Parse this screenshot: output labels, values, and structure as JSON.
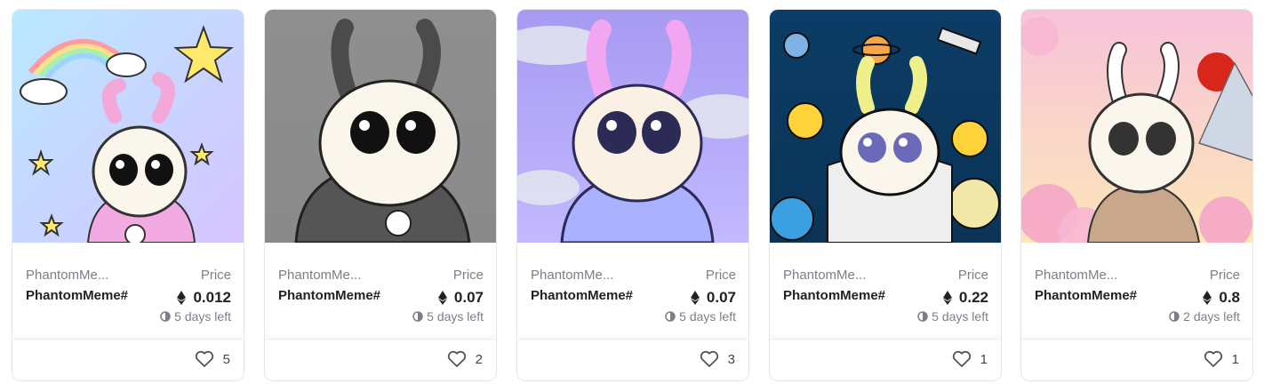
{
  "price_label": "Price",
  "colors": {
    "muted": "#7a7f87",
    "text": "#222222",
    "border": "#e6e6ea"
  },
  "icons": {
    "currency": "ethereum-icon",
    "time": "clock-icon",
    "like": "heart-icon"
  },
  "cards": [
    {
      "collection": "PhantomMe...",
      "name": "PhantomMeme#",
      "price": "0.012",
      "time_left": "5 days left",
      "likes": "5",
      "art": {
        "bg_top": "#b9e9ff",
        "bg_bottom": "#d6c3ff",
        "horn": "#f2a8d8",
        "outfit": "#f3a9e2",
        "theme": "rainbow-stars"
      }
    },
    {
      "collection": "PhantomMe...",
      "name": "PhantomMeme#",
      "price": "0.07",
      "time_left": "5 days left",
      "likes": "2",
      "art": {
        "bg_top": "#8f8f8f",
        "bg_bottom": "#8a8a8a",
        "horn": "#4b4b4b",
        "outfit": "#555555",
        "theme": "grey-hoodie"
      }
    },
    {
      "collection": "PhantomMe...",
      "name": "PhantomMeme#",
      "price": "0.07",
      "time_left": "5 days left",
      "likes": "3",
      "art": {
        "bg_top": "#a79af2",
        "bg_bottom": "#c2b8ff",
        "horn": "#f0a6f0",
        "outfit": "#aab2ff",
        "theme": "clouds"
      }
    },
    {
      "collection": "PhantomMe...",
      "name": "PhantomMeme#",
      "price": "0.22",
      "time_left": "5 days left",
      "likes": "1",
      "art": {
        "bg_top": "#0c3d66",
        "bg_bottom": "#0b3357",
        "horn": "#f0f08a",
        "outfit": "#eeeeee",
        "theme": "space"
      }
    },
    {
      "collection": "PhantomMe...",
      "name": "PhantomMeme#",
      "price": "0.8",
      "time_left": "2 days left",
      "likes": "1",
      "art": {
        "bg_top": "#f7c3da",
        "bg_bottom": "#fde6b8",
        "horn": "#ffffff",
        "outfit": "#c9a78a",
        "theme": "sakura"
      }
    }
  ]
}
